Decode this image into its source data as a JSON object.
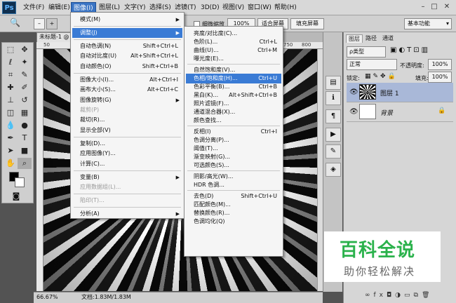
{
  "app": {
    "logo": "Ps"
  },
  "menubar": {
    "items": [
      "文件(F)",
      "编辑(E)",
      "图像(I)",
      "图层(L)",
      "文字(Y)",
      "选择(S)",
      "滤镜(T)",
      "3D(D)",
      "视图(V)",
      "窗口(W)",
      "帮助(H)"
    ],
    "active_index": 2,
    "window_buttons": [
      "–",
      "□",
      "✕"
    ]
  },
  "options": {
    "zoom_icon": "zoom-icon",
    "fine_zoom_label": "细微缩放",
    "zoom_value": "100%",
    "fit_screen": "适合屏幕",
    "fill_screen": "填充屏幕",
    "workspace": "基本功能"
  },
  "document": {
    "tab_title": "未标题-1 @",
    "ruler_marks": [
      "50",
      "750",
      "800"
    ],
    "status_zoom": "66.67%",
    "status_doc": "文档:1.83M/1.83M"
  },
  "image_menu": {
    "items": [
      {
        "label": "模式(M)",
        "arrow": "▶"
      },
      {
        "sep": true
      },
      {
        "label": "调整(J)",
        "arrow": "▶",
        "highlight": true
      },
      {
        "sep": true
      },
      {
        "label": "自动色调(N)",
        "shortcut": "Shift+Ctrl+L"
      },
      {
        "label": "自动对比度(U)",
        "shortcut": "Alt+Shift+Ctrl+L"
      },
      {
        "label": "自动颜色(O)",
        "shortcut": "Shift+Ctrl+B"
      },
      {
        "sep": true
      },
      {
        "label": "图像大小(I)...",
        "shortcut": "Alt+Ctrl+I"
      },
      {
        "label": "画布大小(S)...",
        "shortcut": "Alt+Ctrl+C"
      },
      {
        "label": "图像旋转(G)",
        "arrow": "▶"
      },
      {
        "label": "裁剪(P)",
        "disabled": true
      },
      {
        "label": "裁切(R)..."
      },
      {
        "label": "显示全部(V)"
      },
      {
        "sep": true
      },
      {
        "label": "复制(D)..."
      },
      {
        "label": "应用图像(Y)..."
      },
      {
        "label": "计算(C)..."
      },
      {
        "sep": true
      },
      {
        "label": "变量(B)",
        "arrow": "▶"
      },
      {
        "label": "应用数据组(L)...",
        "disabled": true
      },
      {
        "sep": true
      },
      {
        "label": "陷印(T)...",
        "disabled": true
      },
      {
        "sep": true
      },
      {
        "label": "分析(A)",
        "arrow": "▶"
      }
    ]
  },
  "adjust_menu": {
    "items": [
      {
        "label": "亮度/对比度(C)..."
      },
      {
        "label": "色阶(L)...",
        "shortcut": "Ctrl+L"
      },
      {
        "label": "曲线(U)...",
        "shortcut": "Ctrl+M"
      },
      {
        "label": "曝光度(E)..."
      },
      {
        "sep": true
      },
      {
        "label": "自然饱和度(V)..."
      },
      {
        "label": "色相/饱和度(H)...",
        "shortcut": "Ctrl+U",
        "highlight": true
      },
      {
        "label": "色彩平衡(B)...",
        "shortcut": "Ctrl+B"
      },
      {
        "label": "黑白(K)...",
        "shortcut": "Alt+Shift+Ctrl+B"
      },
      {
        "label": "照片滤镜(F)..."
      },
      {
        "label": "通道混合器(X)..."
      },
      {
        "label": "颜色查找..."
      },
      {
        "sep": true
      },
      {
        "label": "反相(I)",
        "shortcut": "Ctrl+I"
      },
      {
        "label": "色调分离(P)..."
      },
      {
        "label": "阈值(T)..."
      },
      {
        "label": "渐变映射(G)..."
      },
      {
        "label": "可选颜色(S)..."
      },
      {
        "sep": true
      },
      {
        "label": "阴影/高光(W)..."
      },
      {
        "label": "HDR 色调..."
      },
      {
        "sep": true
      },
      {
        "label": "去色(D)",
        "shortcut": "Shift+Ctrl+U"
      },
      {
        "label": "匹配颜色(M)..."
      },
      {
        "label": "替换颜色(R)..."
      },
      {
        "label": "色调均化(Q)"
      }
    ]
  },
  "layers_panel": {
    "tabs": [
      "图层",
      "路径",
      "通道"
    ],
    "kind_filter": "ρ类型",
    "blend_mode": "正常",
    "opacity_label": "不透明度:",
    "opacity_value": "100%",
    "lock_label": "锁定:",
    "fill_label": "填充:",
    "fill_value": "100%",
    "layers": [
      {
        "name": "图层 1",
        "selected": true
      },
      {
        "name": "背景",
        "locked": true
      }
    ],
    "footer_icons": [
      "link-icon",
      "fx-icon",
      "mask-icon",
      "adjustment-icon",
      "folder-icon",
      "new-layer-icon",
      "trash-icon"
    ]
  },
  "watermark": {
    "title": "百科全说",
    "subtitle": "助你轻松解决"
  },
  "colors": {
    "highlight": "#3a7bd5",
    "watermark_green": "#2bb24c"
  }
}
